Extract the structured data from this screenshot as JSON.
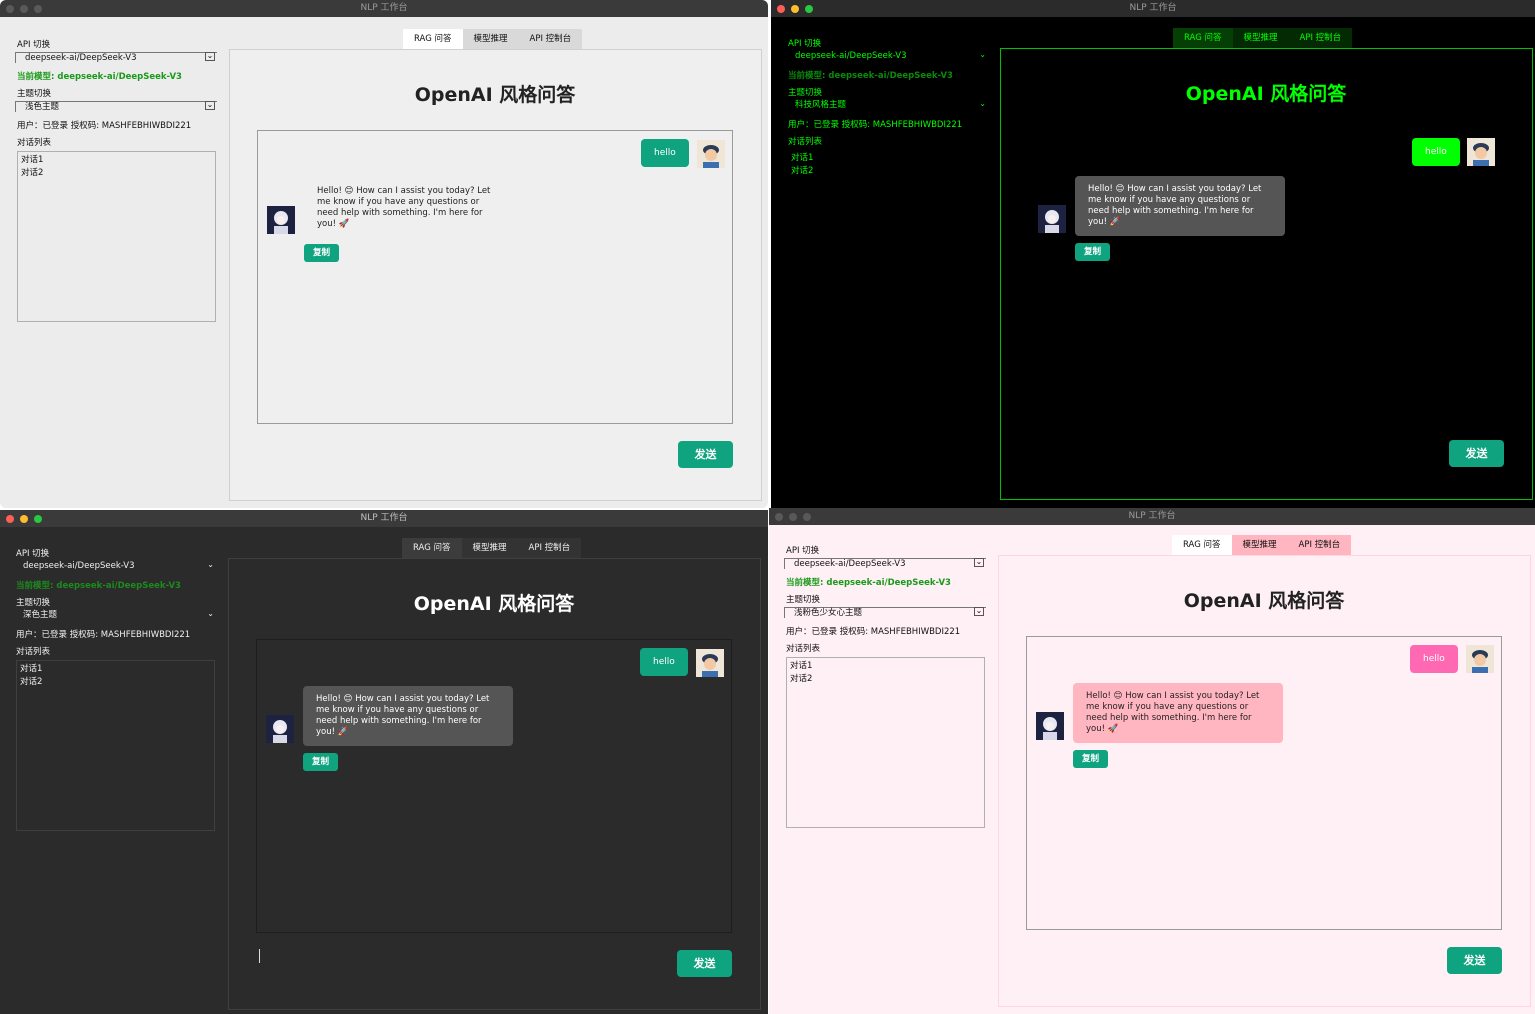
{
  "app": {
    "title": "NLP 工作台"
  },
  "sidebar": {
    "api_label": "API 切换",
    "api_selected": "deepseek-ai/DeepSeek-V3",
    "current_model": "当前模型: deepseek-ai/DeepSeek-V3",
    "theme_label": "主题切换",
    "user_info": "用户：已登录 授权码: MASHFEBHIWBDI221",
    "conversations_label": "对话列表",
    "conversations": [
      "对话1",
      "对话2"
    ]
  },
  "tabs": [
    "RAG 问答",
    "模型推理",
    "API 控制台"
  ],
  "main": {
    "heading": "OpenAI 风格问答"
  },
  "chat": {
    "user_message": "hello",
    "ai_message": "Hello! 😊 How can I assist you today? Let me know if you have any questions or need help with something. I'm here for you! 🚀",
    "copy_label": "复制",
    "send_label": "发送"
  },
  "themes": {
    "light": {
      "name": "浅色主题",
      "accent": "#10a37f",
      "model_color": "#1a9a1a"
    },
    "tech": {
      "name": "科技风格主题",
      "accent": "#00ff00"
    },
    "dark": {
      "name": "深色主题",
      "accent": "#10a37f",
      "model_color": "#1d8a1d"
    },
    "pink": {
      "name": "浅粉色少女心主题",
      "accent": "#ff69b4",
      "model_color": "#1a9a1a"
    }
  },
  "icons": [
    "user-avatar-icon",
    "assistant-avatar-icon",
    "chevron-down-icon"
  ]
}
